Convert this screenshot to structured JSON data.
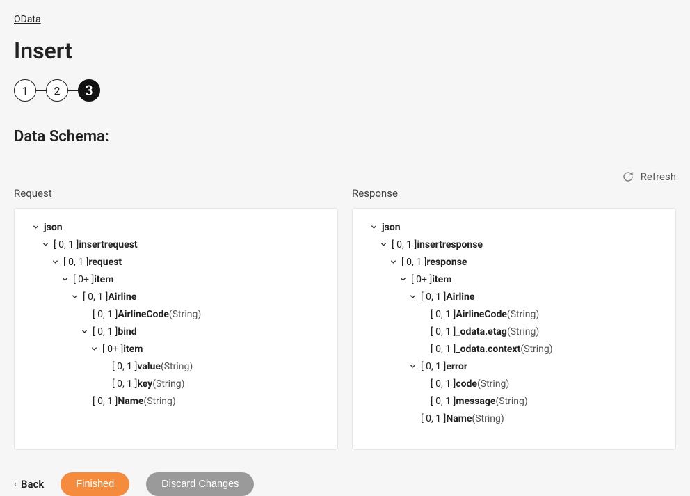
{
  "breadcrumb": "OData",
  "title": "Insert",
  "steps": [
    "1",
    "2",
    "3"
  ],
  "activeStep": 3,
  "sectionTitle": "Data Schema:",
  "refreshLabel": "Refresh",
  "request": {
    "title": "Request",
    "tree": [
      {
        "indent": 0,
        "chevron": true,
        "card": "",
        "name": "json",
        "type": ""
      },
      {
        "indent": 1,
        "chevron": true,
        "card": "[ 0, 1 ]",
        "name": "insertrequest",
        "type": ""
      },
      {
        "indent": 2,
        "chevron": true,
        "card": "[ 0, 1 ]",
        "name": "request",
        "type": ""
      },
      {
        "indent": 3,
        "chevron": true,
        "card": "[ 0+ ]",
        "name": "item",
        "type": ""
      },
      {
        "indent": 4,
        "chevron": true,
        "card": "[ 0, 1 ]",
        "name": "Airline",
        "type": ""
      },
      {
        "indent": 5,
        "chevron": false,
        "card": "[ 0, 1 ]",
        "name": "AirlineCode",
        "type": "(String)"
      },
      {
        "indent": 5,
        "chevron": true,
        "card": "[ 0, 1 ]",
        "name": "bind",
        "type": ""
      },
      {
        "indent": 6,
        "chevron": true,
        "card": "[ 0+ ]",
        "name": "item",
        "type": ""
      },
      {
        "indent": 7,
        "chevron": false,
        "card": "[ 0, 1 ]",
        "name": "value",
        "type": "(String)"
      },
      {
        "indent": 7,
        "chevron": false,
        "card": "[ 0, 1 ]",
        "name": "key",
        "type": "(String)"
      },
      {
        "indent": 5,
        "chevron": false,
        "card": "[ 0, 1 ]",
        "name": "Name",
        "type": "(String)"
      }
    ]
  },
  "response": {
    "title": "Response",
    "tree": [
      {
        "indent": 0,
        "chevron": true,
        "card": "",
        "name": "json",
        "type": ""
      },
      {
        "indent": 1,
        "chevron": true,
        "card": "[ 0, 1 ]",
        "name": "insertresponse",
        "type": ""
      },
      {
        "indent": 2,
        "chevron": true,
        "card": "[ 0, 1 ]",
        "name": "response",
        "type": ""
      },
      {
        "indent": 3,
        "chevron": true,
        "card": "[ 0+ ]",
        "name": "item",
        "type": ""
      },
      {
        "indent": 4,
        "chevron": true,
        "card": "[ 0, 1 ]",
        "name": "Airline",
        "type": ""
      },
      {
        "indent": 5,
        "chevron": false,
        "card": "[ 0, 1 ]",
        "name": "AirlineCode",
        "type": "(String)"
      },
      {
        "indent": 5,
        "chevron": false,
        "card": "[ 0, 1 ]",
        "name": "_odata.etag",
        "type": "(String)"
      },
      {
        "indent": 5,
        "chevron": false,
        "card": "[ 0, 1 ]",
        "name": "_odata.context",
        "type": "(String)"
      },
      {
        "indent": 4,
        "chevron": true,
        "card": "[ 0, 1 ]",
        "name": "error",
        "type": ""
      },
      {
        "indent": 5,
        "chevron": false,
        "card": "[ 0, 1 ]",
        "name": "code",
        "type": "(String)"
      },
      {
        "indent": 5,
        "chevron": false,
        "card": "[ 0, 1 ]",
        "name": "message",
        "type": "(String)"
      },
      {
        "indent": 4,
        "chevron": false,
        "card": "[ 0, 1 ]",
        "name": "Name",
        "type": "(String)"
      }
    ]
  },
  "footer": {
    "back": "Back",
    "finished": "Finished",
    "discard": "Discard Changes"
  }
}
